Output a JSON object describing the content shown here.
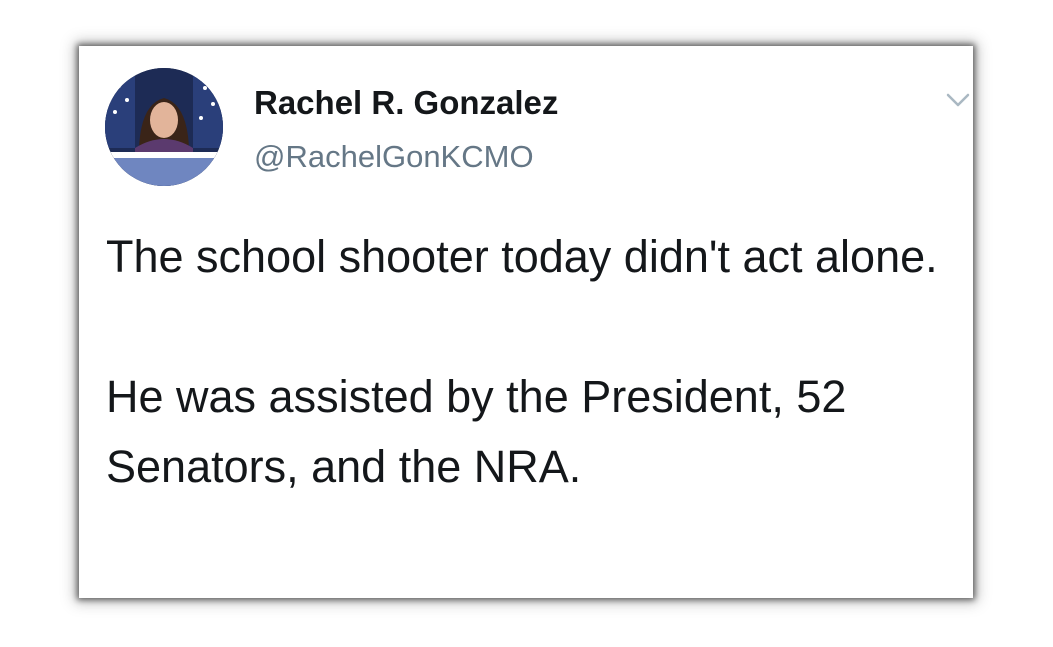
{
  "tweet": {
    "author": {
      "display_name": "Rachel R. Gonzalez",
      "handle": "@RachelGonKCMO",
      "avatar_icon": "profile-photo"
    },
    "menu_icon": "chevron-down-icon",
    "paragraphs": [
      "The school shooter today didn't act alone.",
      "He was assisted by the President, 52 Senators, and the NRA."
    ]
  },
  "colors": {
    "text_primary": "#14171a",
    "text_secondary": "#657786",
    "chevron": "#aab8c2",
    "background": "#ffffff"
  }
}
